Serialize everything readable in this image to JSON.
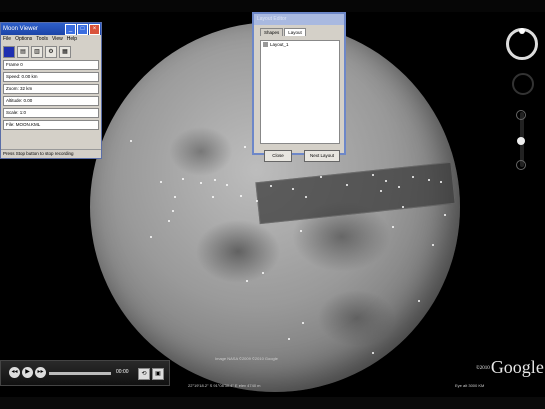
{
  "left_window": {
    "title": "Moon Viewer",
    "menu": [
      "File",
      "Options",
      "Tools",
      "View",
      "Help"
    ],
    "rows": [
      "Frame 0",
      "Speed: 0.00 km",
      "Zoom: 32 km",
      "Altitude: 0.00",
      "Scale: 1:0",
      "File: MOON.KML"
    ],
    "status": "Press Stop button to stop recording"
  },
  "layout_dialog": {
    "title": "Layout Editor",
    "tabs": [
      "Shapes",
      "Layout"
    ],
    "items": [
      "Layout_1"
    ],
    "close_label": "Close",
    "next_label": "Next Layout"
  },
  "player": {
    "time": "00:00"
  },
  "map": {
    "attribution": "Image NASA  ©2009  ©2010 Google",
    "coordinates": "22°19'18.2\" S   91°08'30.4\" E   elev 4740 m",
    "eye_alt": "Eye alt 3000 KM",
    "logo_pre": "©2010",
    "logo": "Google"
  },
  "icons": {
    "play": "play-icon",
    "rewind": "rewind-icon",
    "loop": "loop-icon",
    "close": "close-icon",
    "minimize": "minimize-icon",
    "maximize": "maximize-icon",
    "north_ring": "navigation-ring-icon"
  }
}
